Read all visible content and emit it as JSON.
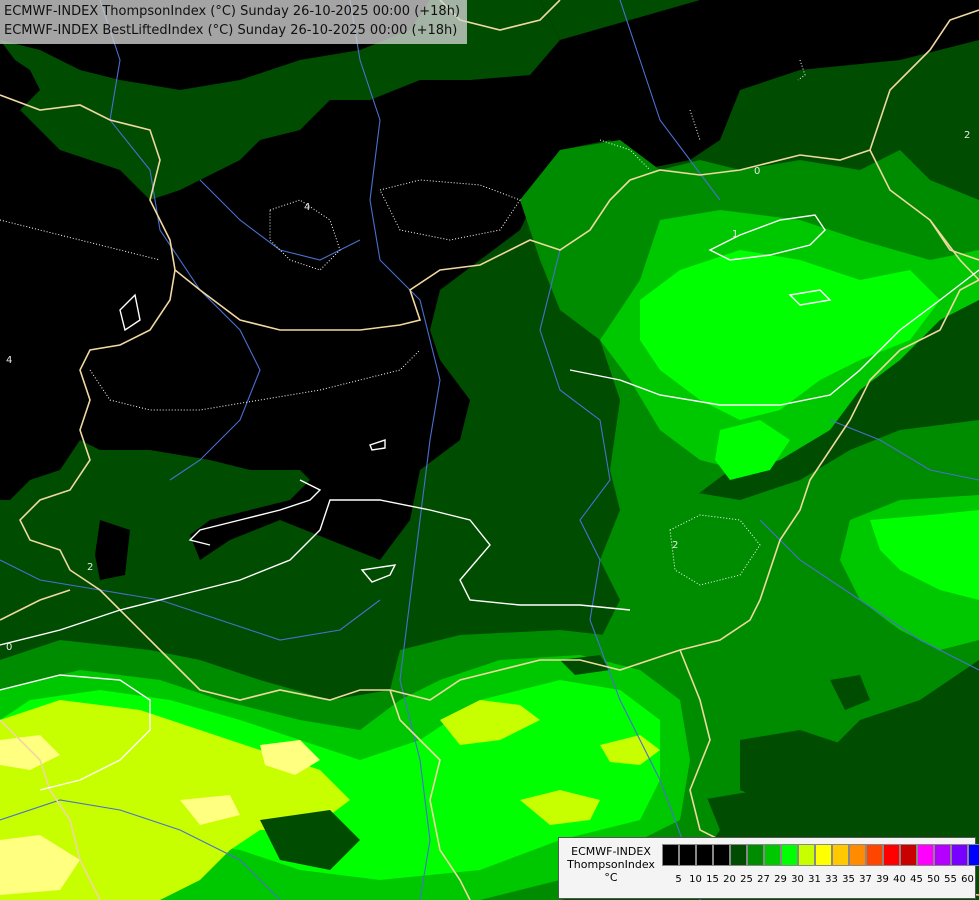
{
  "title": {
    "line1": "ECMWF-INDEX ThompsonIndex (°C) Sunday 26-10-2025 00:00 (+18h)",
    "line2": "ECMWF-INDEX BestLiftedIndex (°C) Sunday 26-10-2025 00:00 (+18h)"
  },
  "legend": {
    "label_model": "ECMWF-INDEX",
    "label_param": "ThompsonIndex",
    "label_unit": "°C",
    "ticks": [
      "5",
      "10",
      "15",
      "20",
      "25",
      "27",
      "29",
      "30",
      "31",
      "33",
      "35",
      "37",
      "39",
      "40",
      "45",
      "50",
      "55",
      "60"
    ],
    "colors": [
      "#000000",
      "#000000",
      "#000000",
      "#000000",
      "#004c00",
      "#008c00",
      "#00c800",
      "#00ff00",
      "#c8ff00",
      "#ffff00",
      "#ffc800",
      "#ff8c00",
      "#ff4600",
      "#ff0000",
      "#c80000",
      "#ff00ff",
      "#b400ff",
      "#7800ff",
      "#0000ff"
    ]
  },
  "contour_labels": [
    "4",
    "4",
    "0",
    "2",
    "2",
    "0",
    "1",
    "2"
  ],
  "palette": {
    "black": "#000000",
    "dark_green": "#004c00",
    "mid_green": "#008c00",
    "green": "#00c800",
    "bright_green": "#00ff00",
    "lime": "#c8ff00",
    "pale_yellow": "#ffff80",
    "border": "#f0d8a0",
    "river": "#4a6fd0",
    "isoline": "#ffffff"
  }
}
